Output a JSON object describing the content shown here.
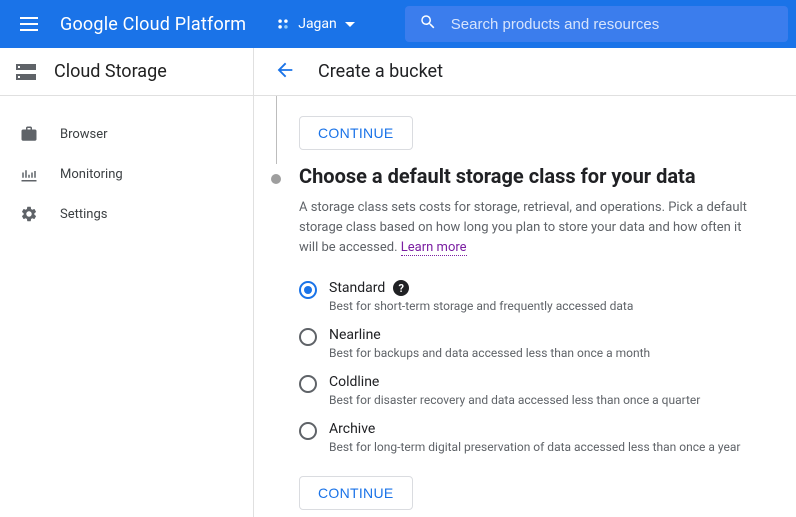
{
  "header": {
    "brand": "Google Cloud Platform",
    "project_name": "Jagan",
    "search_placeholder": "Search products and resources"
  },
  "subheader": {
    "product": "Cloud Storage",
    "page_title": "Create a bucket"
  },
  "sidebar": {
    "items": [
      {
        "label": "Browser"
      },
      {
        "label": "Monitoring"
      },
      {
        "label": "Settings"
      }
    ]
  },
  "buttons": {
    "continue": "CONTINUE"
  },
  "step": {
    "title": "Choose a default storage class for your data",
    "desc_prefix": "A storage class sets costs for storage, retrieval, and operations. Pick a default storage class based on how long you plan to store your data and how often it will be accessed. ",
    "learn_more": "Learn more"
  },
  "storage_classes": [
    {
      "label": "Standard",
      "desc": "Best for short-term storage and frequently accessed data",
      "selected": true,
      "help": true
    },
    {
      "label": "Nearline",
      "desc": "Best for backups and data accessed less than once a month",
      "selected": false,
      "help": false
    },
    {
      "label": "Coldline",
      "desc": "Best for disaster recovery and data accessed less than once a quarter",
      "selected": false,
      "help": false
    },
    {
      "label": "Archive",
      "desc": "Best for long-term digital preservation of data accessed less than once a year",
      "selected": false,
      "help": false
    }
  ]
}
